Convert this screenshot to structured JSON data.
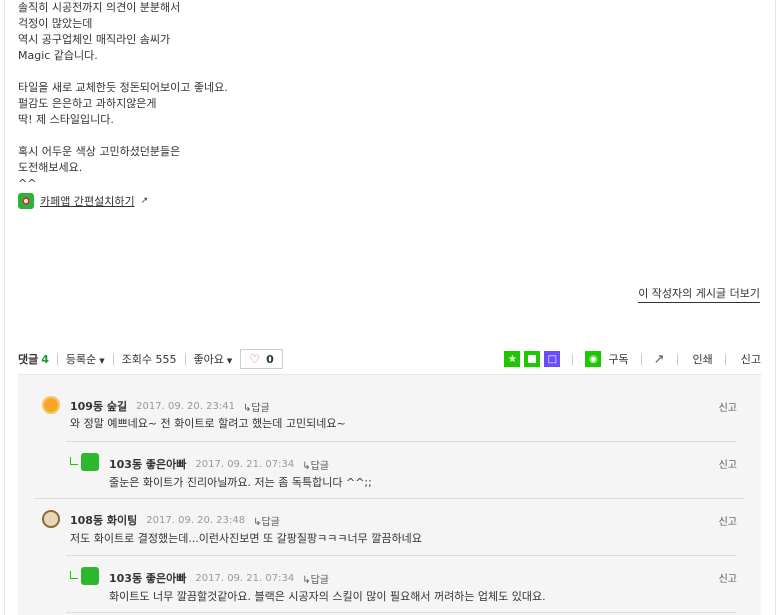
{
  "post": {
    "lines": [
      "솔직히 시공전까지 의견이 분분해서",
      "걱정이 많았는데",
      "역시 공구업체인 매직라인 솜씨가",
      "Magic 같습니다.",
      "",
      "타일을 새로 교체한듯 정돈되어보이고 좋네요.",
      "펄감도 은은하고 과하지않은게",
      "딱! 제 스타일입니다.",
      "",
      "혹시 어두운 색상 고민하셨던분들은",
      "도전해보세요.",
      "^^"
    ],
    "app_link_label": "카페앱 간편설치하기",
    "more_posts_label": "이 작성자의 게시글 더보기"
  },
  "bar": {
    "comments_label": "댓글",
    "comments_count": "4",
    "sort_label": "등록순",
    "views_label": "조회수 555",
    "likes_label": "좋아요",
    "like_count": "0",
    "subscribe_label": "구독",
    "print_label": "인쇄",
    "report_label": "신고"
  },
  "comments": [
    {
      "author": "109동 숲길",
      "date": "2017. 09. 20.  23:41",
      "reply": "답글",
      "text": "와 정말 예쁘네요~ 전 화이트로 할려고 했는데 고민되네요~",
      "report": "신고"
    },
    {
      "author": "103동 좋은아빠",
      "date": "2017. 09. 21.  07:34",
      "reply": "답글",
      "text": "줄눈은 화이트가 진리아닐까요. 저는 좀 독특합니다 ^^;;",
      "report": "신고"
    },
    {
      "author": "108동 화이팅",
      "date": "2017. 09. 20.  23:48",
      "reply": "답글",
      "text": "저도 화이트로 결정했는데...이런사진보면 또 갈팡질팡ㅋㅋㅋ너무 깔끔하네요",
      "report": "신고"
    },
    {
      "author": "103동 좋은아빠",
      "date": "2017. 09. 21.  07:34",
      "reply": "답글",
      "text": "화이트도 너무 깔끔할것같아요. 블랙은 시공자의 스킬이 많이 필요해서 꺼려하는 업체도 있대요.",
      "report": "신고"
    }
  ],
  "colors": {
    "accent_green": "#1ec800",
    "count_green": "#1a9b3d",
    "heart_red": "#e64a4a"
  }
}
